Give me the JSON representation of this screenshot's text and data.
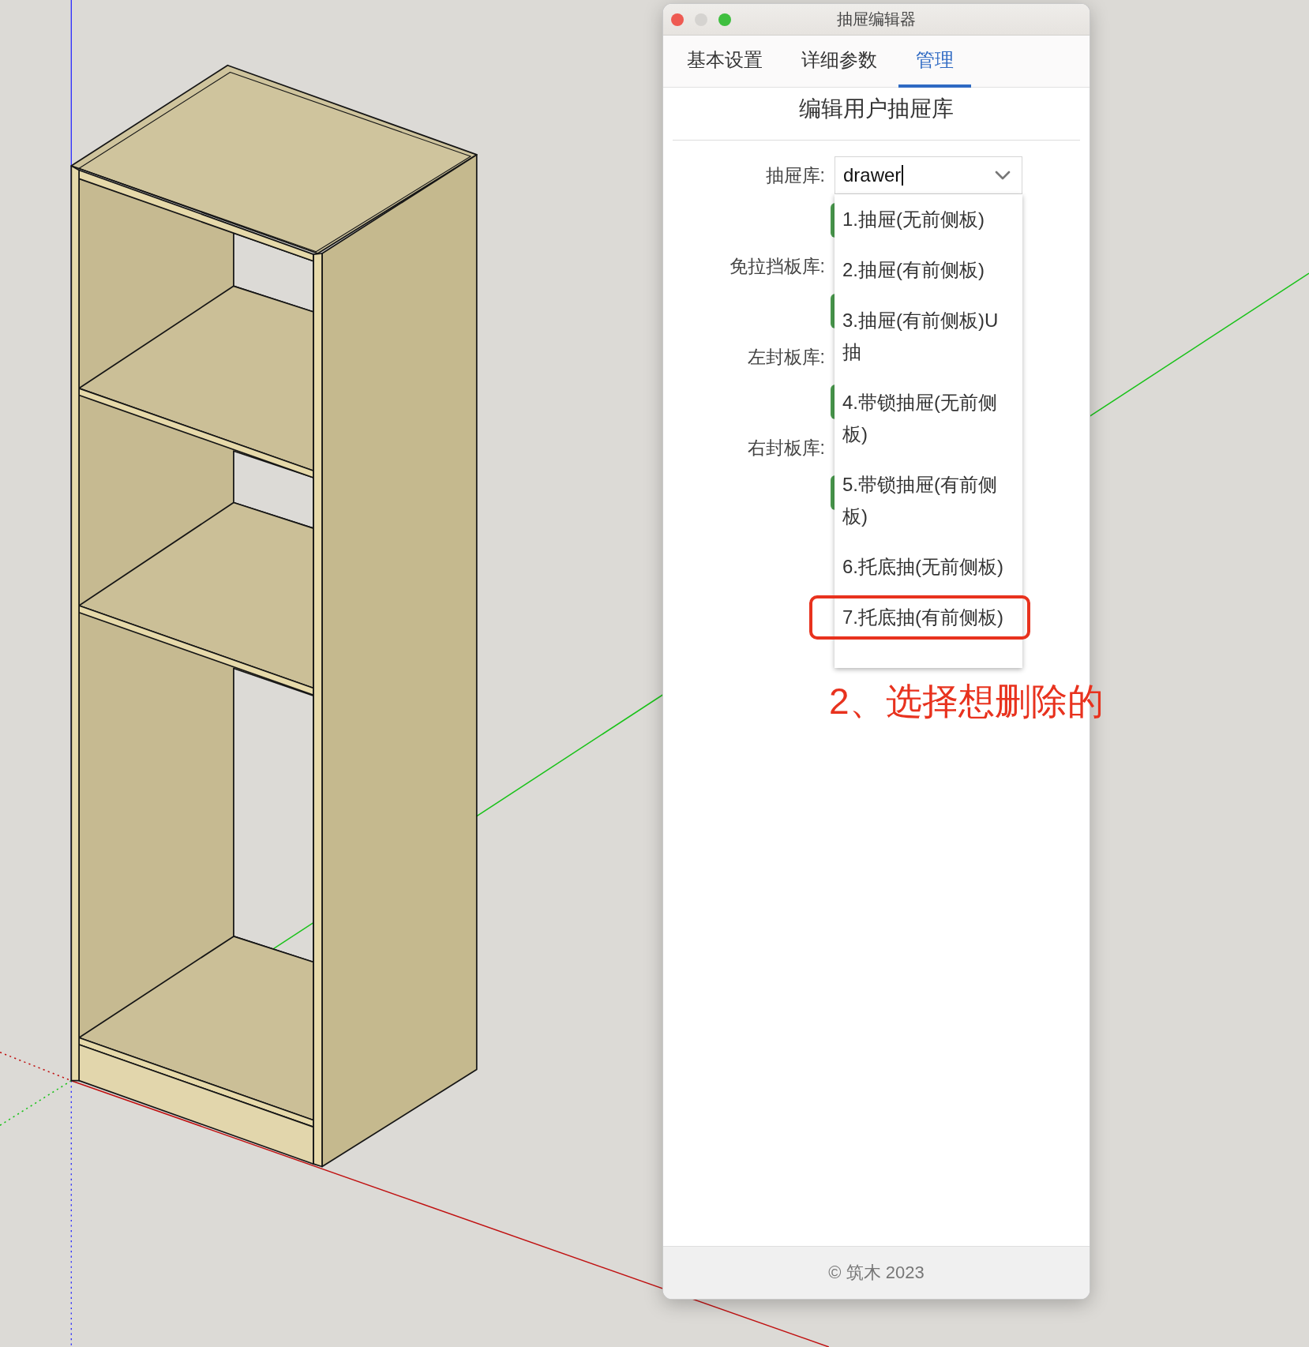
{
  "window": {
    "title": "抽屉编辑器"
  },
  "tabs": [
    {
      "label": "基本设置",
      "selected": false
    },
    {
      "label": "详细参数",
      "selected": false
    },
    {
      "label": "管理",
      "selected": true
    }
  ],
  "heading": "编辑用户抽屉库",
  "form": {
    "fields": [
      {
        "label": "抽屉库:",
        "value": "drawer"
      },
      {
        "label": "免拉挡板库:"
      },
      {
        "label": "左封板库:"
      },
      {
        "label": "右封板库:"
      }
    ]
  },
  "dropdown": {
    "items": [
      {
        "label": "1.抽屉(无前侧板)",
        "highlighted": false
      },
      {
        "label": "2.抽屉(有前侧板)",
        "highlighted": false
      },
      {
        "label": "3.抽屉(有前侧板)U抽",
        "highlighted": false
      },
      {
        "label": "4.带锁抽屉(无前侧板)",
        "highlighted": false
      },
      {
        "label": "5.带锁抽屉(有前侧板)",
        "highlighted": false
      },
      {
        "label": "6.托底抽(无前侧板)",
        "highlighted": false
      },
      {
        "label": "7.托底抽(有前侧板)",
        "highlighted": true
      }
    ]
  },
  "annotation": "2、选择想删除的",
  "footer": "© 筑木 2023"
}
